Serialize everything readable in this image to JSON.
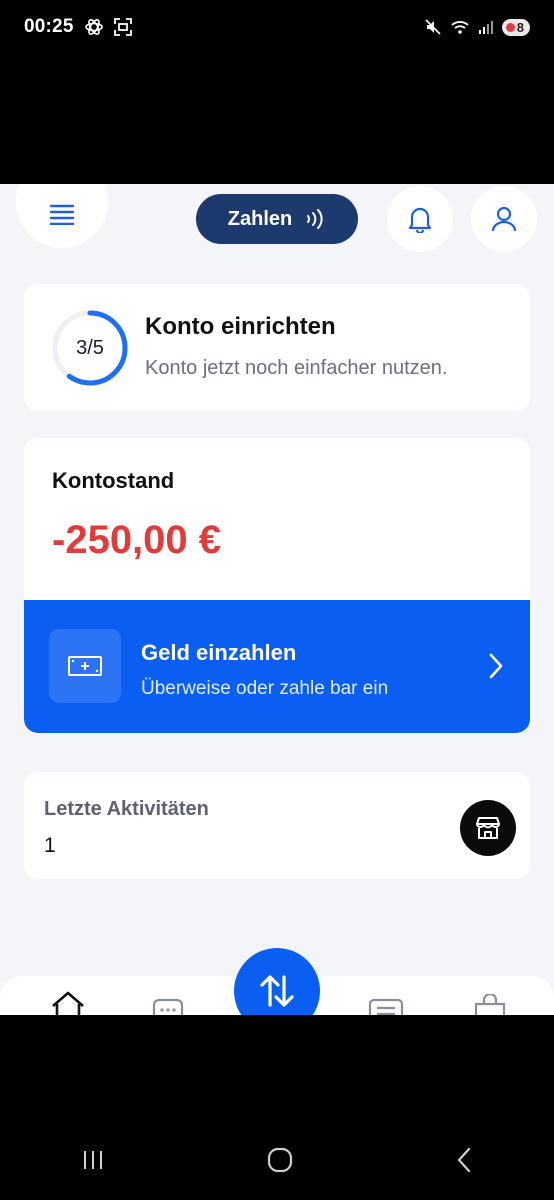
{
  "status_bar": {
    "time": "00:25",
    "battery_level": "8"
  },
  "header": {
    "pay_label": "Zahlen"
  },
  "setup": {
    "progress_text": "3/5",
    "progress_fraction": 0.6,
    "title": "Konto einrichten",
    "subtitle": "Konto jetzt noch einfacher nutzen."
  },
  "balance": {
    "label": "Kontostand",
    "value": "-250,00 €"
  },
  "deposit": {
    "title": "Geld einzahlen",
    "subtitle": "Überweise oder zahle bar ein"
  },
  "activity": {
    "title": "Letzte Aktivitäten",
    "count": "1"
  },
  "colors": {
    "accent": "#0a5ff2",
    "pay_button": "#1d3a6e",
    "negative": "#e23b3b",
    "background": "#f4f5f9"
  },
  "icons": {
    "menu": "menu-icon",
    "pay_contactless": "contactless-icon",
    "notifications": "bell-icon",
    "profile": "user-icon",
    "deposit": "banknote-icon",
    "deposit_arrow": "chevron-right-icon",
    "shop": "store-icon",
    "fab": "transfer-arrows-icon"
  }
}
